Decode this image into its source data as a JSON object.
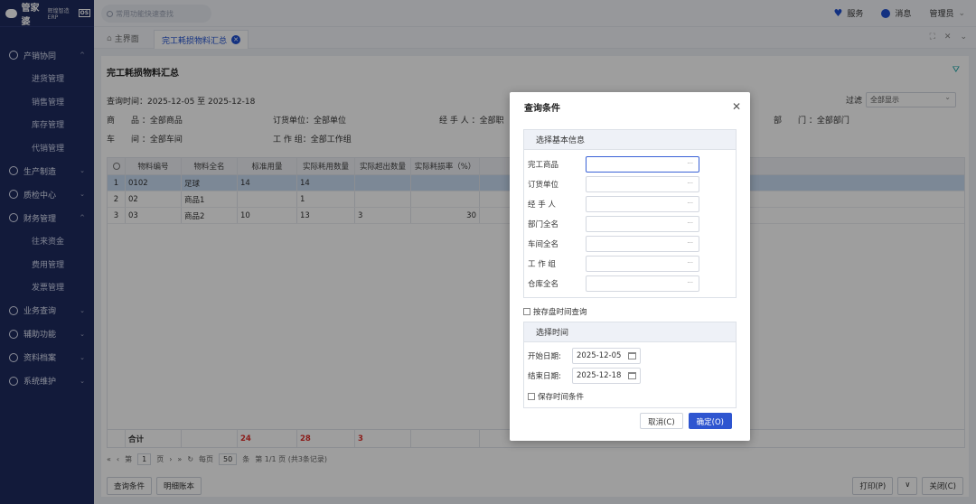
{
  "app": {
    "logo_text": "管家婆",
    "logo_sub": "辉煌智造ERP",
    "version_badge": "OS"
  },
  "sidebar": {
    "groups": [
      {
        "label": "产销协同",
        "icon": "circle-check-icon",
        "expanded": true,
        "items": [
          "进货管理",
          "销售管理",
          "库存管理",
          "代销管理"
        ]
      },
      {
        "label": "生产制造",
        "icon": "factory-icon",
        "expanded": false,
        "items": []
      },
      {
        "label": "质检中心",
        "icon": "shield-icon",
        "expanded": false,
        "items": []
      },
      {
        "label": "财务管理",
        "icon": "money-icon",
        "expanded": true,
        "items": [
          "往来资金",
          "费用管理",
          "发票管理"
        ]
      },
      {
        "label": "业务查询",
        "icon": "search-icon",
        "expanded": false,
        "items": []
      },
      {
        "label": "辅助功能",
        "icon": "tool-icon",
        "expanded": false,
        "items": []
      },
      {
        "label": "资料档案",
        "icon": "archive-icon",
        "expanded": false,
        "items": []
      },
      {
        "label": "系统维护",
        "icon": "gear-icon",
        "expanded": false,
        "items": []
      }
    ]
  },
  "topbar": {
    "search_placeholder": "常用功能快速查找",
    "service": "服务",
    "messages": "消息",
    "user": "管理员"
  },
  "tabs": {
    "home": "主界面",
    "active": "完工耗损物料汇总"
  },
  "page": {
    "title": "完工耗损物料汇总",
    "query_time": "查询时间：2025-12-05 至 2025-12-18",
    "filter_label": "过滤",
    "filter_value": "全部显示",
    "info": {
      "product": "商　　品 ：全部商品",
      "order_unit": "订货单位：全部单位",
      "handler": "经 手 人 ：全部职",
      "dept": "部　　门 ：全部部门",
      "workshop": "车　　间 ：全部车间",
      "workgroup": "工 作 组：全部工作组"
    }
  },
  "table": {
    "columns": [
      "",
      "物料编号",
      "物料全名",
      "标准用量",
      "实际耗用数量",
      "实际超出数量",
      "实际耗损率（%）"
    ],
    "rows": [
      [
        "1",
        "0102",
        "足球",
        "14",
        "14",
        "",
        ""
      ],
      [
        "2",
        "02",
        "商品1",
        "",
        "1",
        "",
        ""
      ],
      [
        "3",
        "03",
        "商品2",
        "10",
        "13",
        "3",
        "30"
      ]
    ],
    "selected_row": 0,
    "summary": {
      "label": "合计",
      "std": "24",
      "actual": "28",
      "over": "3"
    }
  },
  "pager": {
    "page": "1",
    "page_label_pre": "第",
    "page_label_post": "页",
    "per_page_pre": "每页",
    "per_page": "50",
    "per_page_post": "条",
    "info": "第 1/1 页 (共3条记录)"
  },
  "bottom": {
    "query_btn": "查询条件",
    "detail_btn": "明细账本",
    "print_btn": "打印(P)",
    "close_btn": "关闭(C)"
  },
  "modal": {
    "title": "查询条件",
    "basic_section": "选择基本信息",
    "fields": [
      {
        "label": "完工商品",
        "value": ""
      },
      {
        "label": "订货单位",
        "value": ""
      },
      {
        "label": "经 手 人",
        "value": ""
      },
      {
        "label": "部门全名",
        "value": ""
      },
      {
        "label": "车间全名",
        "value": ""
      },
      {
        "label": "工 作 组",
        "value": ""
      },
      {
        "label": "仓库全名",
        "value": ""
      }
    ],
    "by_stock_time": "按存盘时间查询",
    "time_section": "选择时间",
    "start_label": "开始日期:",
    "start_date": "2025-12-05",
    "end_label": "结束日期:",
    "end_date": "2025-12-18",
    "save_time": "保存时间条件",
    "cancel": "取消(C)",
    "ok": "确定(O)"
  }
}
